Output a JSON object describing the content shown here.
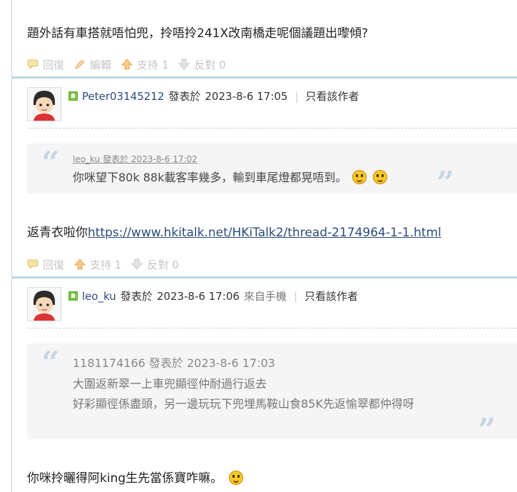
{
  "post1": {
    "text": "題外話有車搭就唔怕兜，拎唔拎241X改南橋走呢個議題出嚟傾?",
    "actions": {
      "reply": "回復",
      "edit": "編輯",
      "support": "支持 1",
      "oppose": "反對 0"
    }
  },
  "post2": {
    "author": "Peter03145212",
    "posted_prefix": "發表於",
    "posted_time": "2023-8-6 17:05",
    "only_author": "只看該作者",
    "quote": {
      "author": "leo_ku",
      "posted_prefix": "發表於",
      "posted_time": "2023-8-6 17:02",
      "text": "你咪望下80k 88k載客率幾多，輸到車尾燈都晃唔到。"
    },
    "text_prefix": "返青衣啦你",
    "link": "https://www.hkitalk.net/HKiTalk2/thread-2174964-1-1.html",
    "actions": {
      "reply": "回復",
      "support": "支持 1",
      "oppose": "反對 0"
    }
  },
  "post3": {
    "author": "leo_ku",
    "posted_prefix": "發表於",
    "posted_time": "2023-8-6 17:06",
    "source": "來自手機",
    "only_author": "只看該作者",
    "quote": {
      "author": "1181174166",
      "posted_prefix": "發表於",
      "posted_time": "2023-8-6 17:03",
      "line1": "大圍返新翠一上車兜顯徑仲耐過行返去",
      "line2": "好彩顯徑係盡頭，另一邊玩玩下兜埋馬鞍山食85K先返愉翠都仲得呀"
    },
    "text": "你咪拎曬得阿king生先當係寶咋嘛。"
  },
  "icons": [
    "reply-icon",
    "edit-icon",
    "support-icon",
    "oppose-icon",
    "online-icon",
    "avatar",
    "emoji-icon"
  ],
  "colors": {
    "link": "#2a4b7c",
    "separator": "#c2d5e3",
    "quote_bg": "#f5f5f5",
    "action": "#c5c5c5"
  }
}
